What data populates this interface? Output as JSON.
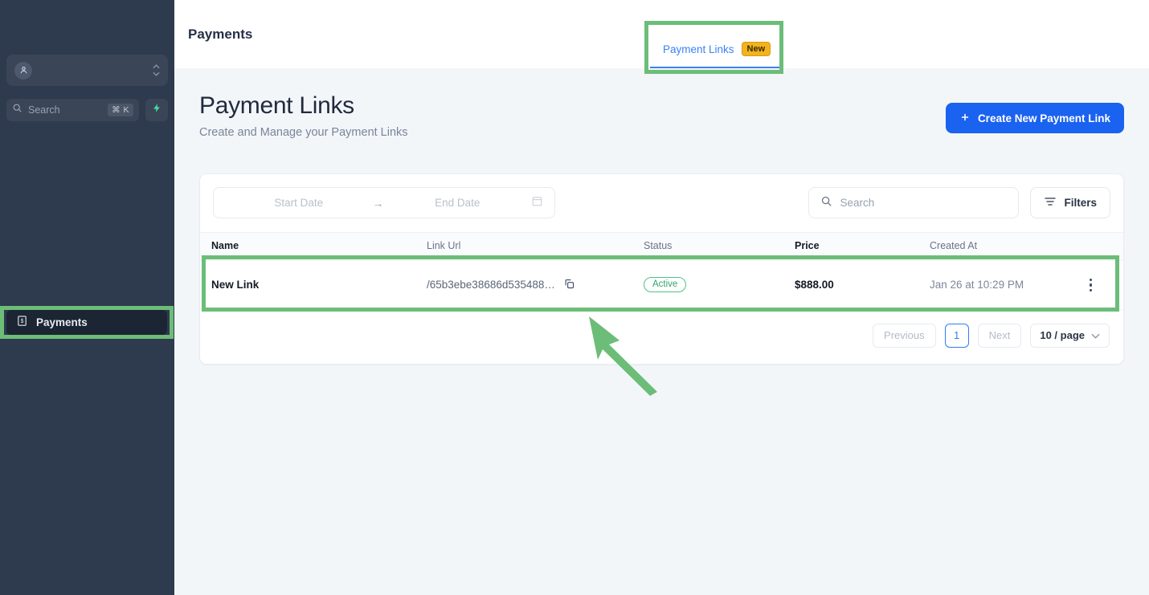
{
  "sidebar": {
    "account": {
      "icon": "user-avatar-icon"
    },
    "search": {
      "placeholder": "Search",
      "shortcut": "⌘ K"
    },
    "quick_action": {
      "icon": "lightning-bolt-icon"
    },
    "items": [
      {
        "label": "Payments",
        "icon": "banknote-icon",
        "active": true
      }
    ]
  },
  "topbar": {
    "title": "Payments",
    "tabs": [
      {
        "label": "Payment Links",
        "badge": "New",
        "active": true
      }
    ]
  },
  "page": {
    "title": "Payment Links",
    "subtitle": "Create and Manage your Payment Links",
    "create_button": "Create New Payment Link"
  },
  "toolbar": {
    "start_date_placeholder": "Start Date",
    "end_date_placeholder": "End Date",
    "range_arrow": "→",
    "calendar_icon": "calendar-icon",
    "search_placeholder": "Search",
    "filters_label": "Filters"
  },
  "table": {
    "columns": [
      "Name",
      "Link Url",
      "Status",
      "Price",
      "Created At"
    ],
    "rows": [
      {
        "name": "New Link",
        "link_url": "/65b3ebe38686d535488…",
        "status": "Active",
        "price": "$888.00",
        "created_at": "Jan 26 at 10:29 PM"
      }
    ]
  },
  "pagination": {
    "previous": "Previous",
    "page": "1",
    "next": "Next",
    "page_size": "10 / page"
  },
  "colors": {
    "sidebar_bg": "#2e3a4e",
    "accent_blue": "#1a62f0",
    "tab_blue": "#3b82f6",
    "badge_amber": "#f2b31f",
    "status_green": "#2fa36a",
    "annotation_green": "#6cbd77"
  }
}
